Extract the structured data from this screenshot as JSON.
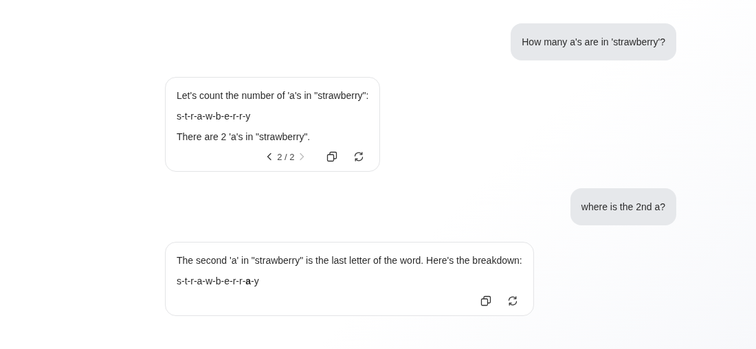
{
  "messages": [
    {
      "kind": "user",
      "text": "How many a's are in 'strawberry'?"
    },
    {
      "kind": "assistant",
      "paragraphs": [
        "Let's count the number of 'a's in \"strawberry\":",
        "s-t-r-a-w-b-e-r-r-y",
        "There are 2 'a's in \"strawberry\"."
      ],
      "pager": {
        "text": "2 / 2",
        "prev_disabled": false,
        "next_disabled": true
      }
    },
    {
      "kind": "user",
      "text": "where is the 2nd a?"
    },
    {
      "kind": "assistant",
      "paragraphs": [
        "The second 'a' in \"strawberry\" is the last letter of the word. Here's the breakdown:",
        "s-t-r-a-w-b-e-r-r-**a**-y"
      ]
    }
  ]
}
